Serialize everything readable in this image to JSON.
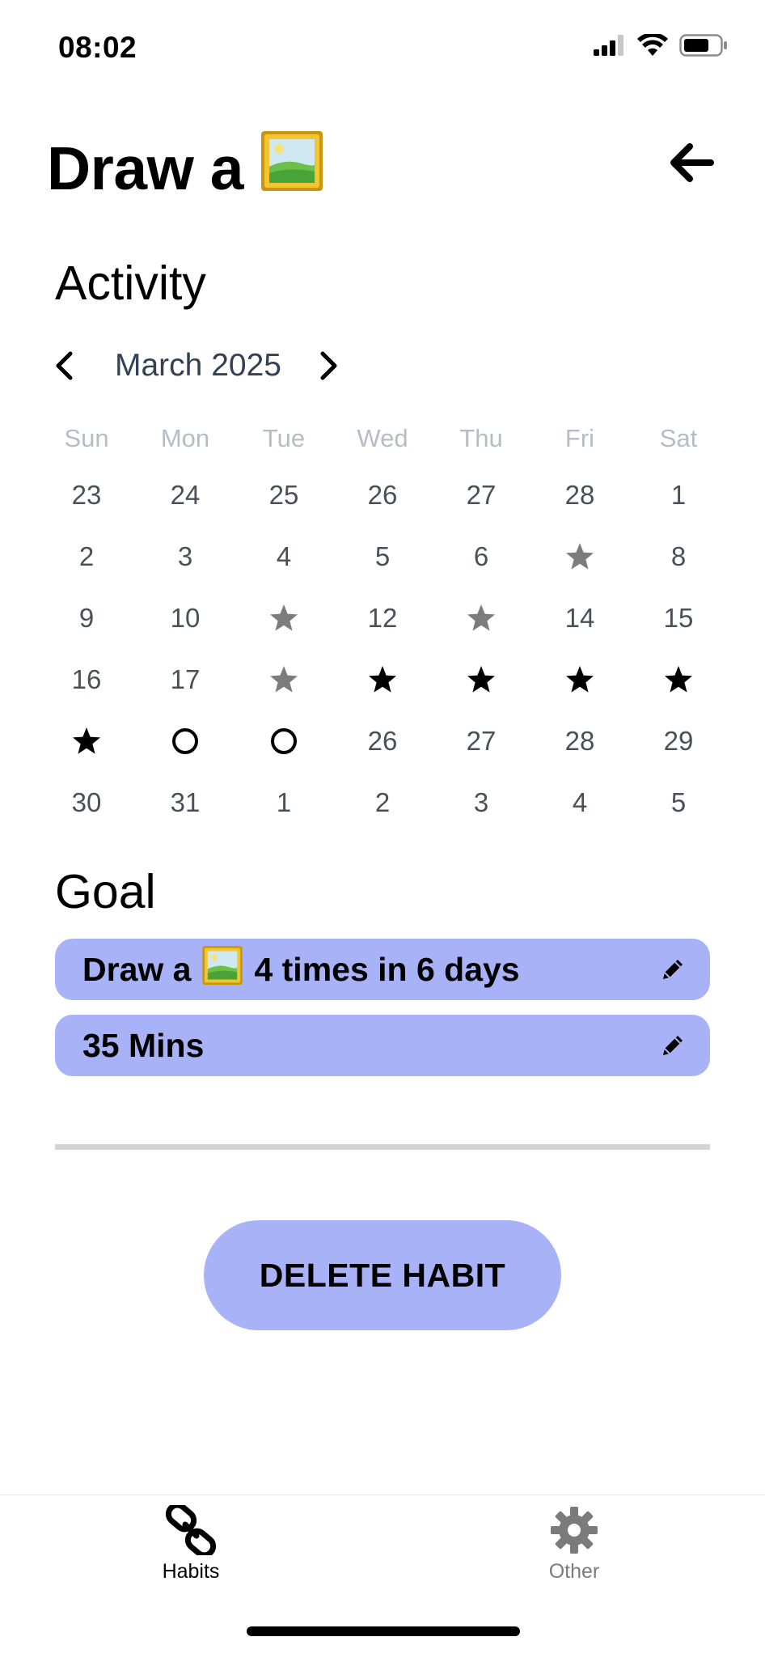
{
  "status_bar": {
    "time": "08:02",
    "icons": [
      "signal-icon",
      "wifi-icon",
      "battery-icon"
    ]
  },
  "header": {
    "title": "Draw a",
    "title_emoji": "framed-picture-icon",
    "back_icon": "arrow-left-icon"
  },
  "activity": {
    "heading": "Activity",
    "month": "March 2025",
    "prev_icon": "chevron-left-icon",
    "next_icon": "chevron-right-icon",
    "weekdays": [
      "Sun",
      "Mon",
      "Tue",
      "Wed",
      "Thu",
      "Fri",
      "Sat"
    ],
    "weeks": [
      [
        {
          "t": "23"
        },
        {
          "t": "24"
        },
        {
          "t": "25"
        },
        {
          "t": "26"
        },
        {
          "t": "27"
        },
        {
          "t": "28"
        },
        {
          "t": "1"
        }
      ],
      [
        {
          "t": "2"
        },
        {
          "t": "3"
        },
        {
          "t": "4"
        },
        {
          "t": "5"
        },
        {
          "t": "6"
        },
        {
          "mark": "star-gray"
        },
        {
          "t": "8"
        }
      ],
      [
        {
          "t": "9"
        },
        {
          "t": "10"
        },
        {
          "mark": "star-gray"
        },
        {
          "t": "12"
        },
        {
          "mark": "star-gray"
        },
        {
          "t": "14"
        },
        {
          "t": "15"
        }
      ],
      [
        {
          "t": "16"
        },
        {
          "t": "17"
        },
        {
          "mark": "star-gray"
        },
        {
          "mark": "star-black"
        },
        {
          "mark": "star-black"
        },
        {
          "mark": "star-black"
        },
        {
          "mark": "star-black"
        }
      ],
      [
        {
          "mark": "star-black"
        },
        {
          "mark": "circle"
        },
        {
          "mark": "circle"
        },
        {
          "t": "26"
        },
        {
          "t": "27"
        },
        {
          "t": "28"
        },
        {
          "t": "29"
        }
      ],
      [
        {
          "t": "30"
        },
        {
          "t": "31"
        },
        {
          "t": "1"
        },
        {
          "t": "2"
        },
        {
          "t": "3"
        },
        {
          "t": "4"
        },
        {
          "t": "5"
        }
      ]
    ]
  },
  "goal": {
    "heading": "Goal",
    "item1_prefix": "Draw a",
    "item1_emoji": "framed-picture-icon",
    "item1_suffix": "4 times in 6 days",
    "item2": "35 Mins",
    "edit_icon": "pencil-icon"
  },
  "actions": {
    "delete_label": "DELETE HABIT"
  },
  "tabs": [
    {
      "label": "Habits",
      "icon": "link-icon",
      "active": true
    },
    {
      "label": "Other",
      "icon": "gear-icon",
      "active": false
    }
  ],
  "colors": {
    "accent": "#a7b2f7",
    "star_gray": "#7c7c7c",
    "star_black": "#000000",
    "weekday": "#b6bcc6",
    "inactive_tab": "#7b7b7b"
  }
}
